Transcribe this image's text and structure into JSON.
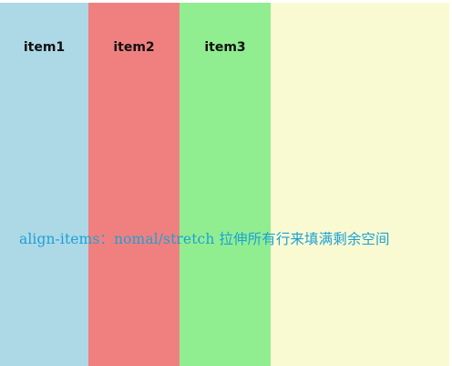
{
  "items": [
    {
      "label": "item1",
      "color": "#add8e6"
    },
    {
      "label": "item2",
      "color": "#f08080"
    },
    {
      "label": "item3",
      "color": "#90ee90"
    }
  ],
  "container_color": "#fafad2",
  "caption": "align-items：nomal/stretch 拉伸所有行来填满剩余空间",
  "caption_color": "#1ea0d6"
}
